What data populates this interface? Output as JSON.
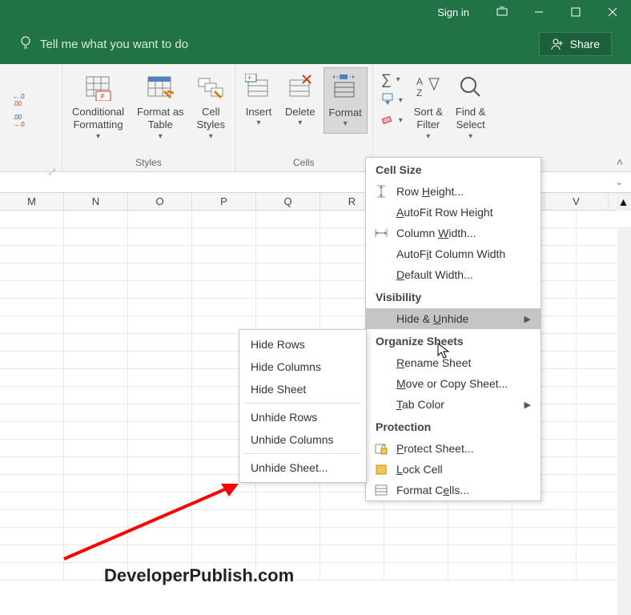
{
  "titlebar": {
    "signin": "Sign in"
  },
  "tellbar": {
    "placeholder": "Tell me what you want to do",
    "share": "Share"
  },
  "ribbon": {
    "decimal": {
      "inc": ".0",
      "dec": ".00"
    },
    "conditional": "Conditional\nFormatting",
    "formatas": "Format as\nTable",
    "cellstyles": "Cell\nStyles",
    "styles_label": "Styles",
    "insert": "Insert",
    "delete": "Delete",
    "format": "Format",
    "cells_label": "Cells",
    "sortfilter": "Sort &\nFilter",
    "findselect": "Find &\nSelect"
  },
  "columns": [
    "M",
    "N",
    "O",
    "P",
    "Q",
    "R",
    "",
    "",
    "",
    "V"
  ],
  "menu": {
    "cellsize": "Cell Size",
    "rowheight": "Row Height...",
    "autofitrow": "AutoFit Row Height",
    "colwidth": "Column Width...",
    "autofitcol": "AutoFit Column Width",
    "defwidth": "Default Width...",
    "visibility": "Visibility",
    "hideunhide": "Hide & Unhide",
    "organize": "Organize Sheets",
    "rename": "Rename Sheet",
    "movecopy": "Move or Copy Sheet...",
    "tabcolor": "Tab Color",
    "protection": "Protection",
    "protectsheet": "Protect Sheet...",
    "lockcell": "Lock Cell",
    "formatcells": "Format Cells..."
  },
  "submenu": {
    "hiderows": "Hide Rows",
    "hidecols": "Hide Columns",
    "hidesheet": "Hide Sheet",
    "unhiderows": "Unhide Rows",
    "unhidecols": "Unhide Columns",
    "unhidesheet": "Unhide Sheet..."
  },
  "watermark": "DeveloperPublish.com"
}
